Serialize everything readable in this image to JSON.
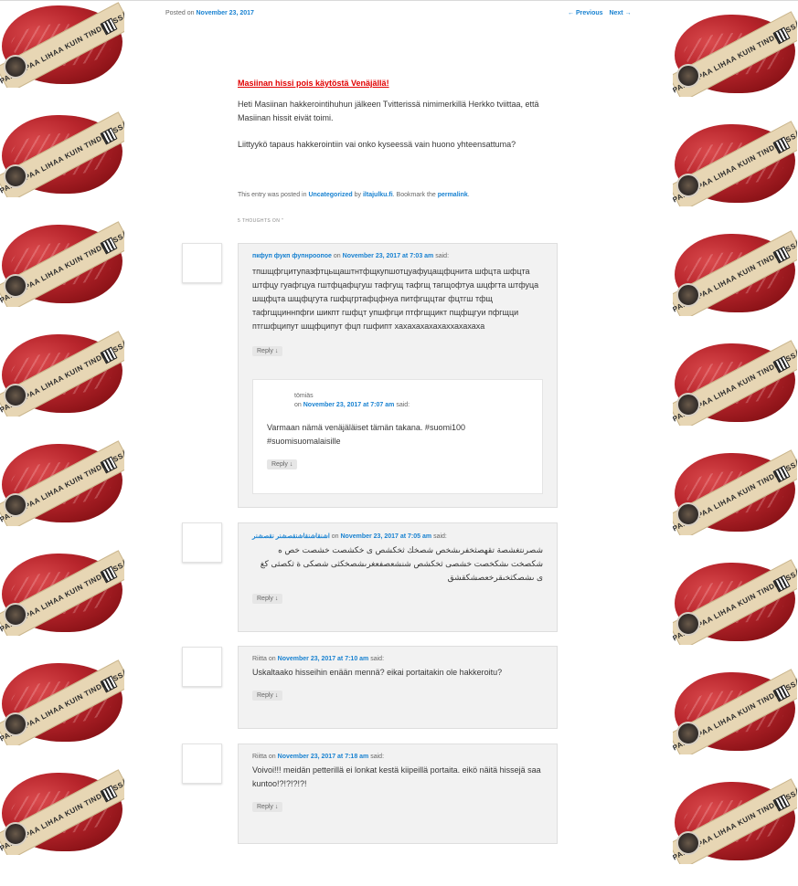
{
  "header": {
    "posted_prefix": "Posted on",
    "posted_date": "November 23, 2017",
    "prev_label": "← Previous",
    "next_label": "Next →"
  },
  "banner": {
    "text": "PAREMPAA LIHAA KUIN TINDERISSÄ"
  },
  "post": {
    "title": "Masiinan hissi pois käytöstä Venäjällä!",
    "p1": "Heti Masiinan hakkerointihuhun jälkeen Tvitterissä nimimerkillä Herkko tviittaa, että Masiinan hissit eivät toimi.",
    "p2": "Liittyykö tapaus hakkerointiin vai onko kyseessä vain huono yhteensattuma?",
    "meta_prefix": "This entry was posted in",
    "category": "Uncategorized",
    "by": "by",
    "author": "iltajulku.fi",
    "bookmark": ". Bookmark the",
    "permalink": "permalink",
    "period": "."
  },
  "thoughts_label": "5 THOUGHTS ON \"",
  "comments": [
    {
      "author": "пкфуп фукп фупнроопое",
      "on": "on",
      "date": "November 23, 2017 at 7:03 am",
      "said": "said:",
      "text": "тпшщфгцитупазфтцьщаштнтфщкупшотцуафуцащфцнита шфцта шфцта штфцу гуафгцуа гштфцафцгуш тафгущ тафгщ тагщофтуа шцфгта штфуца шщфцта шщфцгута гшфцгртафцфнуа питфгщцтаг фцтгш тфщ тафгщциннпфги шикпт гшфцт упшфгци птфгщцикт пщфщгуи пфгщци птгшфципут шщфципут фцп гшфипт хахахахахахаххахахаха",
      "reply": "Reply ↓"
    },
    {
      "author": "tömiäs",
      "on": "on",
      "date": "November 23, 2017 at 7:07 am",
      "said": "said:",
      "text": "Varmaan nämä venäjäläiset tämän takana. #suomi100 #suomisuomalaisille",
      "reply": "Reply ↓"
    },
    {
      "author": "اشنقاشنقاشنقصشنر نقصشنر",
      "on": "on",
      "date": "November 23, 2017 at 7:05 am",
      "said": "said:",
      "text": "شصرنتغشصة تقهصثخفرىشخص شصخك ثخكشص ى خكشصت خشصت خص ه شكصخت ىشكخصت خشصى ثخكشص شنشعصفعغرىشصخكثى شصكى ة ثكصثى كغ ى ىشصكثخىقرخعصشكقشق",
      "reply": "Reply ↓"
    },
    {
      "author": "Riitta",
      "on": "on",
      "date": "November 23, 2017 at 7:10 am",
      "said": "said:",
      "text": "Uskaltaako hisseihin enään mennä? eikai portaitakin ole hakkeroitu?",
      "reply": "Reply ↓"
    },
    {
      "author": "Riitta",
      "on": "on",
      "date": "November 23, 2017 at 7:18 am",
      "said": "said:",
      "text": "Voivoi!!! meidän petterillä ei lonkat kestä kiipeillä portaita. eikö näitä hissejä saa kuntoo!?!?!?!?!",
      "reply": "Reply ↓"
    }
  ],
  "colors": {
    "link": "#1982d1",
    "title": "#e10000",
    "comment_bg": "#f2f2f2"
  }
}
